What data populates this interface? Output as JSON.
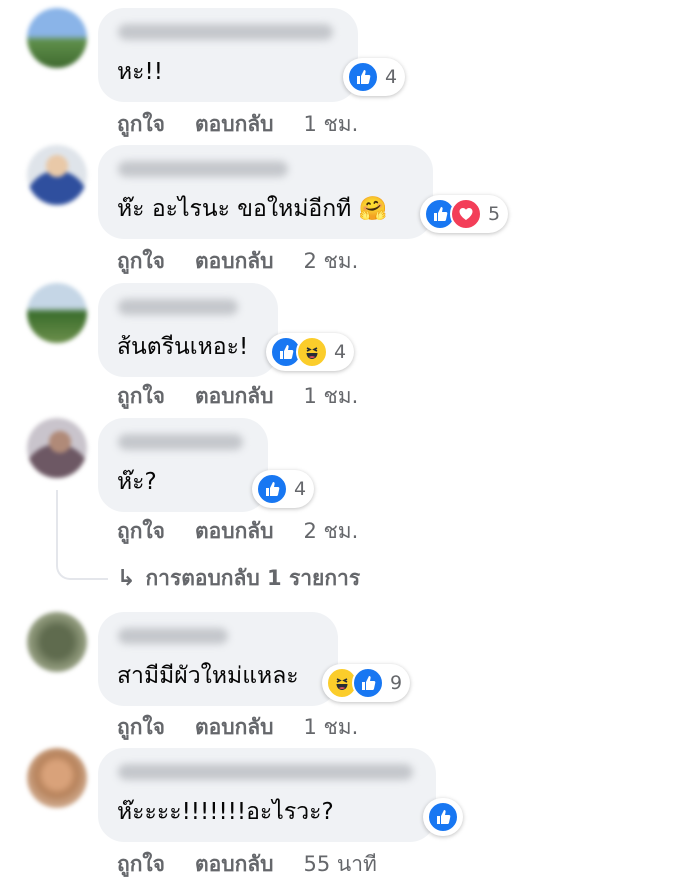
{
  "actions": {
    "like_label": "ถูกใจ",
    "reply_label": "ตอบกลับ"
  },
  "colors": {
    "like_blue": "#1877f2",
    "love_red": "#f33e58",
    "haha_yellow": "#fbcd2b",
    "bubble_bg": "#f0f2f5",
    "meta_gray": "#65676b"
  },
  "comments": [
    {
      "text": "หะ!!",
      "reactions": [
        "like"
      ],
      "reaction_count": "4",
      "time": "1 ชม."
    },
    {
      "text": "ห๊ะ อะไรนะ ขอใหม่อีกที 🤗",
      "reactions": [
        "like",
        "love"
      ],
      "reaction_count": "5",
      "time": "2 ชม."
    },
    {
      "text": "ส้นตรีนเหอะ!",
      "reactions": [
        "like",
        "haha"
      ],
      "reaction_count": "4",
      "time": "1 ชม."
    },
    {
      "text": "ห๊ะ?",
      "reactions": [
        "like"
      ],
      "reaction_count": "4",
      "time": "2 ชม."
    },
    {
      "text": "สามีมีผัวใหม่แหละ",
      "reactions": [
        "haha",
        "like"
      ],
      "reaction_count": "9",
      "time": "1 ชม."
    },
    {
      "text": "ห๊ะะะะ!!!!!!!อะไรวะ?",
      "reactions": [
        "like"
      ],
      "reaction_count": "",
      "time": "55 นาที"
    }
  ],
  "replies_link": {
    "arrow": "↳",
    "label": "การตอบกลับ 1 รายการ"
  }
}
